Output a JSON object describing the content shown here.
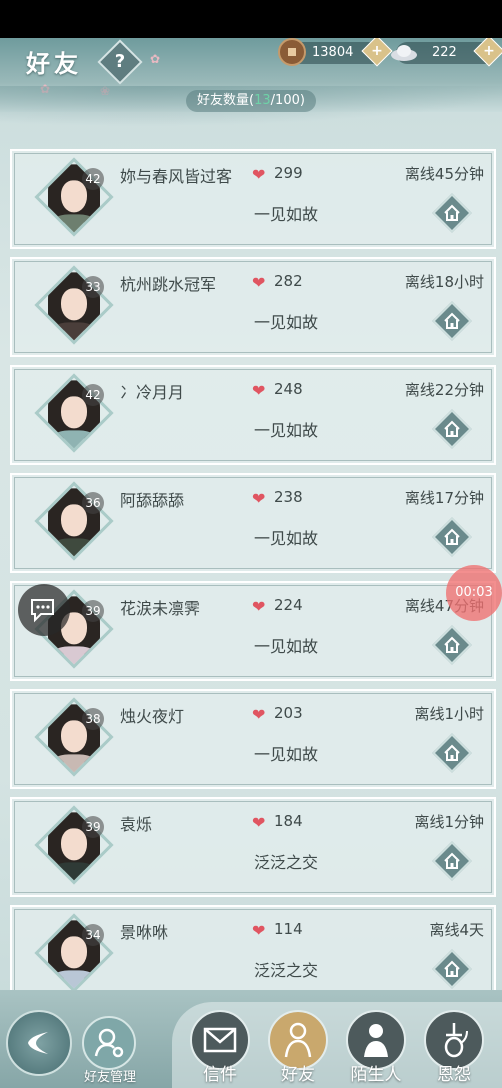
{
  "header": {
    "title": "好友",
    "help_label": "?",
    "copper": "13804",
    "silver": "222",
    "count_prefix": "好友数量(",
    "count_current": "13",
    "count_suffix": "/100)"
  },
  "friends": [
    {
      "level": "42",
      "name": "妳与春风皆过客",
      "hearts": "299",
      "relation": "一见如故",
      "status": "离线45分钟"
    },
    {
      "level": "33",
      "name": "杭州跳水冠军",
      "hearts": "282",
      "relation": "一见如故",
      "status": "离线18小时"
    },
    {
      "level": "42",
      "name": "冫冷月月",
      "hearts": "248",
      "relation": "一见如故",
      "status": "离线22分钟"
    },
    {
      "level": "36",
      "name": "阿舔舔舔",
      "hearts": "238",
      "relation": "一见如故",
      "status": "离线17分钟"
    },
    {
      "level": "39",
      "name": "花涙未凛霁",
      "hearts": "224",
      "relation": "一见如故",
      "status": "离线47分钟"
    },
    {
      "level": "38",
      "name": "烛火夜灯",
      "hearts": "203",
      "relation": "一见如故",
      "status": "离线1小时"
    },
    {
      "level": "39",
      "name": "袁烁",
      "hearts": "184",
      "relation": "泛泛之交",
      "status": "离线1分钟"
    },
    {
      "level": "34",
      "name": "景咻咻",
      "hearts": "114",
      "relation": "泛泛之交",
      "status": "离线4天"
    }
  ],
  "overlay": {
    "timer": "00:03"
  },
  "bottom": {
    "manage_label": "好友管理",
    "tabs": [
      {
        "label": "信件"
      },
      {
        "label": "好友"
      },
      {
        "label": "陌生人"
      },
      {
        "label": "恩怨"
      }
    ]
  },
  "colors": {
    "accent_green": "#6fd2a8",
    "heart_red": "#e05561",
    "active_tab_gold": "#c9a86d"
  }
}
